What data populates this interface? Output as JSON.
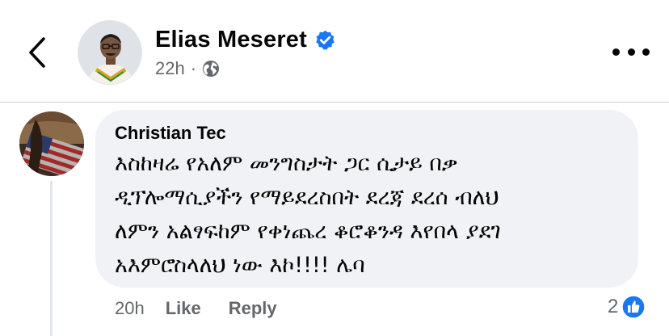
{
  "post": {
    "author_name": "Elias Meseret",
    "time": "22h",
    "separator": "·"
  },
  "comment": {
    "author_name": "Christian Tec",
    "lines": [
      "እስከዛሬ የአለም መንግስታት ጋር ሲታይ በቃ",
      "ዲፕሎማሲያችን የማይደረስበት ደረጃ ደረሰ ብለህ",
      "ለምን አልፃፍከም የቀነጨረ ቆሮቆንዳ እየበላ ያደገ",
      "አእምሮስላለህ ነው እኮ!!!! ሌባ"
    ],
    "time": "20h",
    "like_label": "Like",
    "reply_label": "Reply",
    "reaction_count": "2"
  },
  "icons": {
    "back": "chevron-left-icon",
    "verified": "verified-badge-icon",
    "privacy": "globe-icon",
    "more": "more-options-icon",
    "reaction": "like-reaction-icon"
  },
  "colors": {
    "brand_blue": "#1877f2",
    "bubble_bg": "#f0f2f5",
    "secondary_text": "#65676b",
    "primary_text": "#050505"
  }
}
